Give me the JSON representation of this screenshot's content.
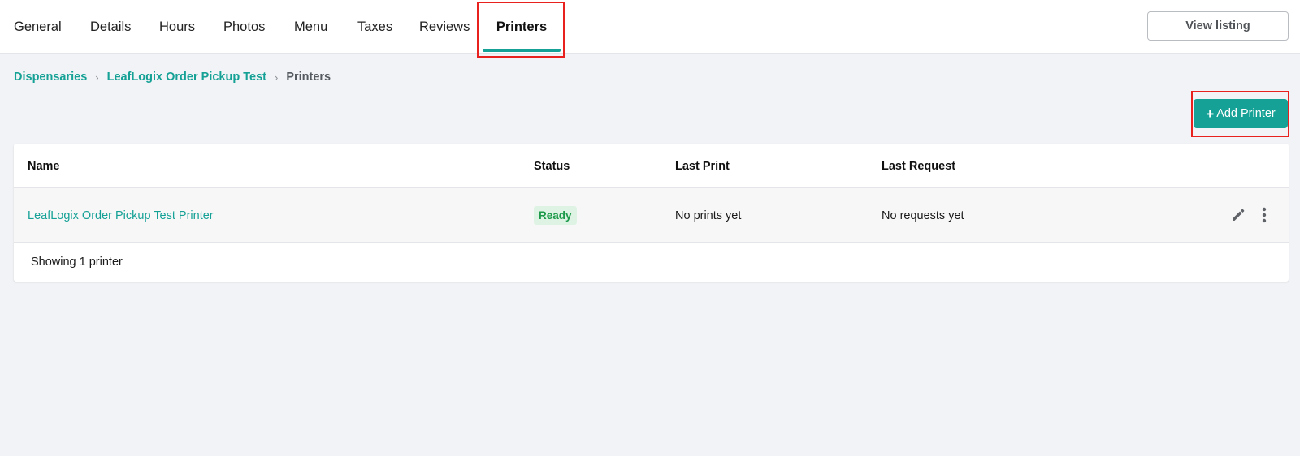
{
  "nav": {
    "tabs": [
      {
        "label": "General"
      },
      {
        "label": "Details"
      },
      {
        "label": "Hours"
      },
      {
        "label": "Photos"
      },
      {
        "label": "Menu"
      },
      {
        "label": "Taxes"
      },
      {
        "label": "Reviews"
      },
      {
        "label": "Printers",
        "active": true
      }
    ],
    "view_listing_label": "View listing"
  },
  "breadcrumb": {
    "items": [
      "Dispensaries",
      "LeafLogix Order Pickup Test"
    ],
    "separator": "›",
    "current": "Printers"
  },
  "actions": {
    "add_printer_plus": "+",
    "add_printer_label": "Add Printer"
  },
  "table": {
    "columns": [
      "Name",
      "Status",
      "Last Print",
      "Last Request"
    ],
    "rows": [
      {
        "name": "LeafLogix Order Pickup Test Printer",
        "status": "Ready",
        "last_print": "No prints yet",
        "last_request": "No requests yet"
      }
    ],
    "footer": "Showing 1 printer"
  },
  "colors": {
    "accent": "#15a195",
    "status_ready_bg": "#dff3e4",
    "status_ready_text": "#1c9a4a",
    "highlight": "#e8211f"
  },
  "icons": {
    "row_edit": "pencil-icon",
    "row_more": "more-vertical-icon"
  }
}
